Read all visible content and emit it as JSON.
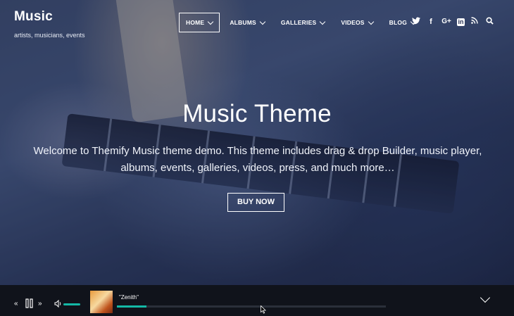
{
  "site": {
    "title": "Music",
    "tagline": "artists, musicians, events"
  },
  "nav": {
    "items": [
      {
        "label": "HOME",
        "active": true
      },
      {
        "label": "ALBUMS",
        "active": false
      },
      {
        "label": "GALLERIES",
        "active": false
      },
      {
        "label": "VIDEOS",
        "active": false
      },
      {
        "label": "BLOG",
        "active": false
      }
    ],
    "social": {
      "twitter": "twitter-icon",
      "facebook_glyph": "f",
      "googleplus_glyph": "G+",
      "linkedin_glyph": "in",
      "rss": "rss-icon",
      "search": "search-icon"
    }
  },
  "hero": {
    "title": "Music Theme",
    "text": "Welcome to Themify Music theme demo. This theme includes drag & drop Builder, music player, albums, events, galleries, videos, press, and much more…",
    "button": "BUY NOW"
  },
  "player": {
    "song_title": "\"Zenith\"",
    "progress": 0.11,
    "volume": 0.7,
    "accent": "#14b8a6",
    "controls": {
      "prev_glyph": "«",
      "next_glyph": "»",
      "pause_icon": "pause-icon",
      "volume_icon": "volume-icon",
      "collapse_icon": "chevron-down-icon"
    }
  }
}
